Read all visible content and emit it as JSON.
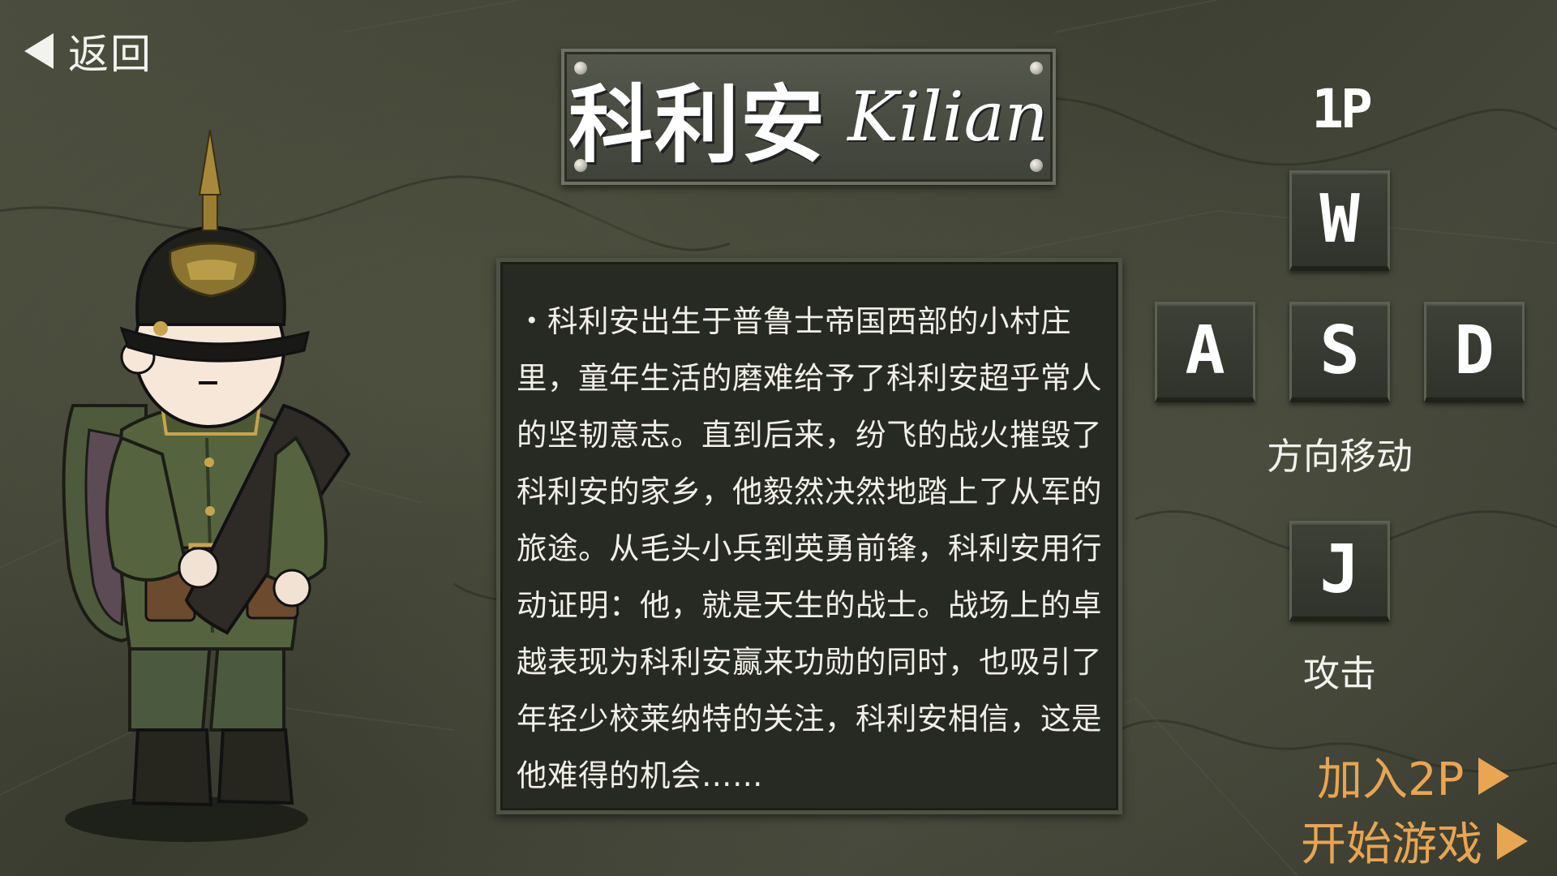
{
  "back": {
    "label": "返回",
    "icon": "back-triangle-icon"
  },
  "character": {
    "name_cn": "科利安",
    "name_en": "Kilian"
  },
  "description": "・科利安出生于普鲁士帝国西部的小村庄里，童年生活的磨难给予了科利安超乎常人的坚韧意志。直到后来，纷飞的战火摧毁了科利安的家乡，他毅然决然地踏上了从军的旅途。从毛头小兵到英勇前锋，科利安用行动证明：他，就是天生的战士。战场上的卓越表现为科利安赢来功勋的同时，也吸引了年轻少校莱纳特的关注，科利安相信，这是他难得的机会……",
  "controls": {
    "player": "1P",
    "keys": {
      "up": "W",
      "left": "A",
      "down": "S",
      "right": "D",
      "attack": "J"
    },
    "move_label": "方向移动",
    "attack_label": "攻击"
  },
  "menu": {
    "join_2p": "加入2P",
    "start_game": "开始游戏"
  },
  "colors": {
    "accent": "#e8a552",
    "text": "#f2f2ee",
    "panel": "#272a22"
  }
}
